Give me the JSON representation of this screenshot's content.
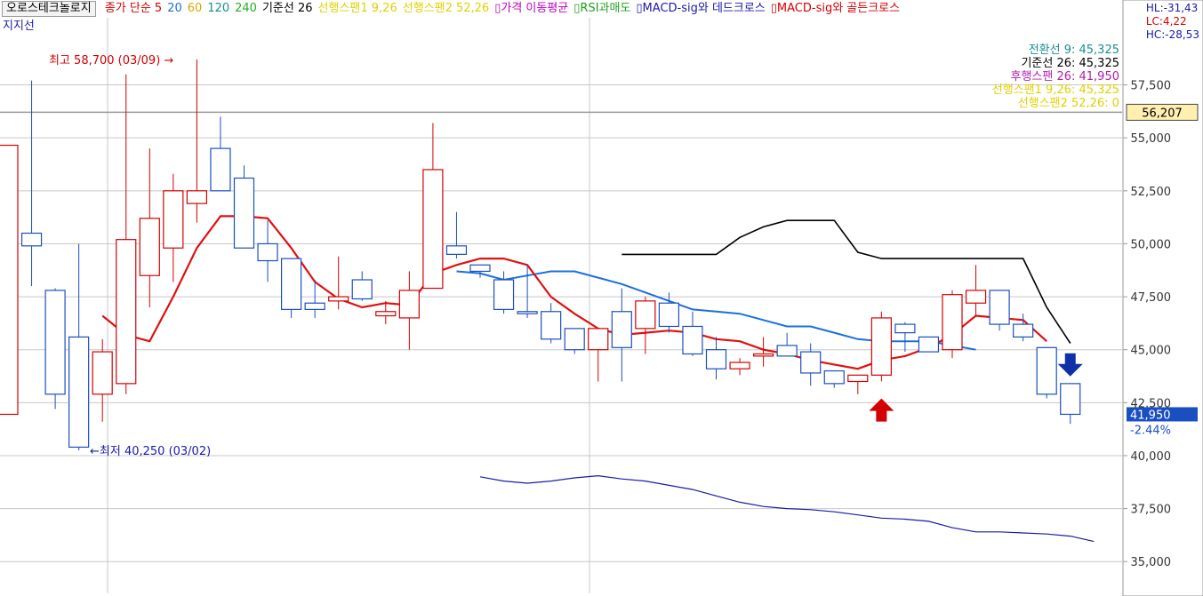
{
  "header": {
    "stock_name": "오로스테크놀로지",
    "indicators": [
      {
        "label": "종가 단순 5",
        "color": "#d40000"
      },
      {
        "label": "20",
        "color": "#1a6fe0"
      },
      {
        "label": "60",
        "color": "#d8a800"
      },
      {
        "label": "120",
        "color": "#1a8f8f"
      },
      {
        "label": "240",
        "color": "#20b020"
      },
      {
        "label": "기준선 26",
        "color": "#000000"
      },
      {
        "label": "선행스팬1 9,26",
        "color": "#e0d000"
      },
      {
        "label": "선행스팬2 52,26",
        "color": "#e0d000"
      },
      {
        "label": "▯가격 이동평균",
        "color": "#c000c0"
      },
      {
        "label": "▯RSI과매도",
        "color": "#20a020"
      },
      {
        "label": "▯MACD-sig와 데드크로스",
        "color": "#1a1aa8"
      },
      {
        "label": "▯MACD-sig와 골든크로스",
        "color": "#d40000"
      }
    ],
    "subtitle": "지지선"
  },
  "stats": [
    {
      "label": "HL:-31,43",
      "color": "#1a1aa8"
    },
    {
      "label": "LC:4,22",
      "color": "#d40000"
    },
    {
      "label": "HC:-28,53",
      "color": "#1a1aa8"
    }
  ],
  "colors": {
    "up": "#d40000",
    "down": "#1a4fc0",
    "ma5": "#e01010",
    "ma20": "#1a6fe0",
    "baseline": "#000000",
    "lower_line": "#1a1aa8",
    "grid": "#c8c8c8"
  },
  "chart_data": {
    "type": "candlestick",
    "ylim": [
      33500,
      60500
    ],
    "yticks": [
      "57,500",
      "55,000",
      "52,500",
      "50,000",
      "47,500",
      "45,000",
      "42,500",
      "40,000",
      "37,500",
      "35,000"
    ],
    "ytick_values": [
      57500,
      55000,
      52500,
      50000,
      47500,
      45000,
      42500,
      40000,
      37500,
      35000
    ],
    "candles": [
      {
        "o": 41950,
        "h": 54650,
        "l": 41950,
        "c": 54650
      },
      {
        "o": 50500,
        "h": 57700,
        "l": 48000,
        "c": 49900
      },
      {
        "o": 47800,
        "h": 47900,
        "l": 42200,
        "c": 42900
      },
      {
        "o": 45600,
        "h": 50000,
        "l": 40250,
        "c": 40400
      },
      {
        "o": 42900,
        "h": 45500,
        "l": 41600,
        "c": 44900
      },
      {
        "o": 43400,
        "h": 58000,
        "l": 42900,
        "c": 50200
      },
      {
        "o": 48500,
        "h": 54500,
        "l": 47000,
        "c": 51200
      },
      {
        "o": 49800,
        "h": 53300,
        "l": 48200,
        "c": 52500
      },
      {
        "o": 51900,
        "h": 58700,
        "l": 51000,
        "c": 52500
      },
      {
        "o": 54500,
        "h": 56000,
        "l": 53500,
        "c": 52500
      },
      {
        "o": 53100,
        "h": 53700,
        "l": 49900,
        "c": 49800
      },
      {
        "o": 50000,
        "h": 51100,
        "l": 48200,
        "c": 49200
      },
      {
        "o": 49300,
        "h": 49300,
        "l": 46500,
        "c": 46900
      },
      {
        "o": 47200,
        "h": 48300,
        "l": 46500,
        "c": 46900
      },
      {
        "o": 47300,
        "h": 49400,
        "l": 46900,
        "c": 47500
      },
      {
        "o": 48300,
        "h": 48700,
        "l": 47300,
        "c": 47400
      },
      {
        "o": 46600,
        "h": 47300,
        "l": 46200,
        "c": 46800
      },
      {
        "o": 46500,
        "h": 48700,
        "l": 45000,
        "c": 47800
      },
      {
        "o": 47900,
        "h": 55700,
        "l": 47900,
        "c": 53500
      },
      {
        "o": 49900,
        "h": 51500,
        "l": 49300,
        "c": 49500
      },
      {
        "o": 49000,
        "h": 49000,
        "l": 48400,
        "c": 48700
      },
      {
        "o": 48300,
        "h": 48700,
        "l": 46700,
        "c": 46900
      },
      {
        "o": 46800,
        "h": 49000,
        "l": 46500,
        "c": 46700
      },
      {
        "o": 46800,
        "h": 47200,
        "l": 45300,
        "c": 45500
      },
      {
        "o": 46000,
        "h": 46000,
        "l": 44800,
        "c": 45000
      },
      {
        "o": 45000,
        "h": 46000,
        "l": 43500,
        "c": 46000
      },
      {
        "o": 46800,
        "h": 47900,
        "l": 43500,
        "c": 45100
      },
      {
        "o": 46000,
        "h": 47500,
        "l": 44800,
        "c": 47300
      },
      {
        "o": 47200,
        "h": 47700,
        "l": 45800,
        "c": 46100
      },
      {
        "o": 46100,
        "h": 46800,
        "l": 44700,
        "c": 44800
      },
      {
        "o": 45000,
        "h": 45600,
        "l": 43600,
        "c": 44100
      },
      {
        "o": 44100,
        "h": 44600,
        "l": 43800,
        "c": 44400
      },
      {
        "o": 44700,
        "h": 45600,
        "l": 44200,
        "c": 44800
      },
      {
        "o": 45200,
        "h": 45800,
        "l": 44800,
        "c": 44700
      },
      {
        "o": 44900,
        "h": 45300,
        "l": 43300,
        "c": 43900
      },
      {
        "o": 44000,
        "h": 44000,
        "l": 43200,
        "c": 43400
      },
      {
        "o": 43500,
        "h": 43800,
        "l": 42900,
        "c": 43800
      },
      {
        "o": 43800,
        "h": 46800,
        "l": 43500,
        "c": 46500
      },
      {
        "o": 46200,
        "h": 46300,
        "l": 44900,
        "c": 45800
      },
      {
        "o": 45600,
        "h": 45600,
        "l": 44900,
        "c": 44900
      },
      {
        "o": 45000,
        "h": 47800,
        "l": 44600,
        "c": 47600
      },
      {
        "o": 47200,
        "h": 49000,
        "l": 46600,
        "c": 47800
      },
      {
        "o": 47800,
        "h": 47800,
        "l": 45900,
        "c": 46200
      },
      {
        "o": 46200,
        "h": 46700,
        "l": 45400,
        "c": 45600
      },
      {
        "o": 45100,
        "h": 45100,
        "l": 42700,
        "c": 42900
      },
      {
        "o": 43400,
        "h": 43400,
        "l": 41500,
        "c": 41950
      }
    ],
    "ma5": [
      null,
      null,
      null,
      null,
      46600,
      45700,
      45400,
      47500,
      49800,
      51300,
      51300,
      51200,
      49800,
      48200,
      47400,
      47000,
      47200,
      47100,
      48600,
      49000,
      49300,
      49300,
      49000,
      47500,
      46700,
      46000,
      45700,
      45800,
      45900,
      45800,
      45500,
      45400,
      45000,
      44800,
      44500,
      44300,
      44100,
      44500,
      44700,
      45100,
      45700,
      46600,
      46500,
      46400,
      45400
    ],
    "ma20": [
      null,
      null,
      null,
      null,
      null,
      null,
      null,
      null,
      null,
      null,
      null,
      null,
      null,
      null,
      null,
      null,
      null,
      null,
      null,
      48700,
      48600,
      48300,
      48500,
      48700,
      48700,
      48400,
      48100,
      47700,
      47300,
      46900,
      46800,
      46700,
      46400,
      46100,
      46100,
      45800,
      45500,
      45400,
      45400,
      45400,
      45200,
      45000
    ],
    "baseline": [
      null,
      null,
      null,
      null,
      null,
      null,
      null,
      null,
      null,
      null,
      null,
      null,
      null,
      null,
      null,
      null,
      null,
      null,
      null,
      null,
      null,
      null,
      null,
      null,
      null,
      null,
      49500,
      49500,
      49500,
      49500,
      49500,
      50300,
      50800,
      51100,
      51100,
      51100,
      49600,
      49300,
      49300,
      49300,
      49300,
      49300,
      49300,
      49300,
      47000,
      45300
    ],
    "lower_line": [
      null,
      null,
      null,
      null,
      null,
      null,
      null,
      null,
      null,
      null,
      null,
      null,
      null,
      null,
      null,
      null,
      null,
      null,
      null,
      null,
      39000,
      38800,
      38700,
      38800,
      38950,
      39050,
      38900,
      38800,
      38600,
      38400,
      38100,
      37800,
      37600,
      37500,
      37450,
      37350,
      37200,
      37050,
      37000,
      36900,
      36600,
      36400,
      36400,
      36350,
      36300,
      36200,
      35950
    ],
    "current_price": "41,950",
    "current_value": 41950,
    "change": "-2.44%",
    "marker_price": "56,207",
    "marker_value": 56207,
    "high_label": "최고 58,700 (03/09) →",
    "low_label": "←최저 40,250 (03/02)",
    "ichimoku": [
      {
        "label": "전환선 9: 45,325",
        "color": "#1a8f8f"
      },
      {
        "label": "기준선 26: 45,325",
        "color": "#000000"
      },
      {
        "label": "후행스팬 26: 41,950",
        "color": "#b020b0"
      },
      {
        "label": "선행스팬1 9,26: 45,325",
        "color": "#e0d000"
      },
      {
        "label": "선행스팬2 52,26: 0",
        "color": "#e0d000"
      }
    ]
  }
}
